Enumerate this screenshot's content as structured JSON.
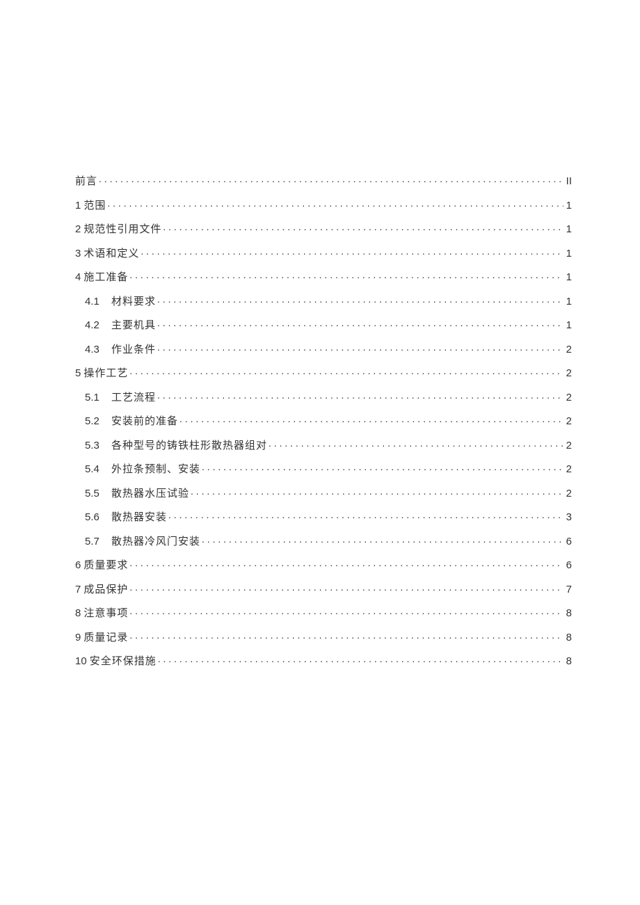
{
  "toc": [
    {
      "level": 1,
      "num": "",
      "title": "前言",
      "page": "II",
      "gap": false
    },
    {
      "level": 1,
      "num": "1",
      "title": "范围",
      "page": "1",
      "gap": true
    },
    {
      "level": 1,
      "num": "2",
      "title": "规范性引用文件",
      "page": "1",
      "gap": true
    },
    {
      "level": 1,
      "num": "3",
      "title": "术语和定义",
      "page": "1",
      "gap": true
    },
    {
      "level": 1,
      "num": "4",
      "title": "施工准备",
      "page": "1",
      "gap": false
    },
    {
      "level": 2,
      "num": "4.1",
      "title": "材料要求",
      "page": "1",
      "gap": false
    },
    {
      "level": 2,
      "num": "4.2",
      "title": "主要机具",
      "page": "1",
      "gap": false
    },
    {
      "level": 2,
      "num": "4.3",
      "title": "作业条件",
      "page": "2",
      "gap": false
    },
    {
      "level": 1,
      "num": "5",
      "title": "操作工艺",
      "page": "2",
      "gap": true
    },
    {
      "level": 2,
      "num": "5.1",
      "title": "工艺流程",
      "page": "2",
      "gap": false
    },
    {
      "level": 2,
      "num": "5.2",
      "title": "安装前的准备",
      "page": "2",
      "gap": false
    },
    {
      "level": 2,
      "num": "5.3",
      "title": "各种型号的铸铁柱形散热器组对",
      "page": "2",
      "gap": false
    },
    {
      "level": 2,
      "num": "5.4",
      "title": "外拉条预制、安装",
      "page": "2",
      "gap": false
    },
    {
      "level": 2,
      "num": "5.5",
      "title": "散热器水压试验",
      "page": "2",
      "gap": false
    },
    {
      "level": 2,
      "num": "5.6",
      "title": "散热器安装",
      "page": "3",
      "gap": false
    },
    {
      "level": 2,
      "num": "5.7",
      "title": "散热器冷风门安装",
      "page": "6",
      "gap": false
    },
    {
      "level": 1,
      "num": "6",
      "title": "质量要求",
      "page": "6",
      "gap": true
    },
    {
      "level": 1,
      "num": "7",
      "title": "成品保护",
      "page": "7",
      "gap": true
    },
    {
      "level": 1,
      "num": "8",
      "title": "注意事项",
      "page": "8",
      "gap": true
    },
    {
      "level": 1,
      "num": "9",
      "title": "质量记录",
      "page": "8",
      "gap": true
    },
    {
      "level": 1,
      "num": "10",
      "title": "安全环保措施",
      "page": "8",
      "gap": true
    }
  ]
}
